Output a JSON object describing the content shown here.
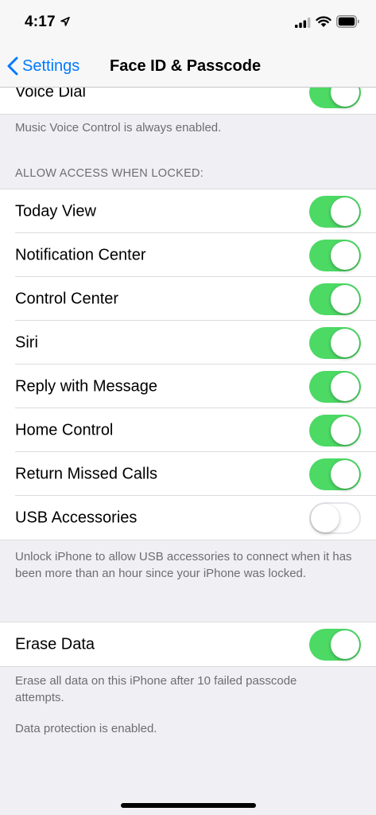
{
  "status_bar": {
    "time": "4:17"
  },
  "nav": {
    "back_label": "Settings",
    "title": "Face ID & Passcode"
  },
  "voice_dial": {
    "label": "Voice Dial",
    "enabled": true
  },
  "voice_footer": "Music Voice Control is always enabled.",
  "locked_section": {
    "header": "ALLOW ACCESS WHEN LOCKED:",
    "items": [
      {
        "label": "Today View",
        "enabled": true
      },
      {
        "label": "Notification Center",
        "enabled": true
      },
      {
        "label": "Control Center",
        "enabled": true
      },
      {
        "label": "Siri",
        "enabled": true
      },
      {
        "label": "Reply with Message",
        "enabled": true
      },
      {
        "label": "Home Control",
        "enabled": true
      },
      {
        "label": "Return Missed Calls",
        "enabled": true
      },
      {
        "label": "USB Accessories",
        "enabled": false
      }
    ],
    "footer": "Unlock iPhone to allow USB accessories to connect when it has been more than an hour since your iPhone was locked."
  },
  "erase_section": {
    "label": "Erase Data",
    "enabled": true,
    "footer1": "Erase all data on this iPhone after 10 failed passcode attempts.",
    "footer2": "Data protection is enabled."
  },
  "colors": {
    "accent": "#007aff",
    "toggle_on": "#4cd964"
  }
}
